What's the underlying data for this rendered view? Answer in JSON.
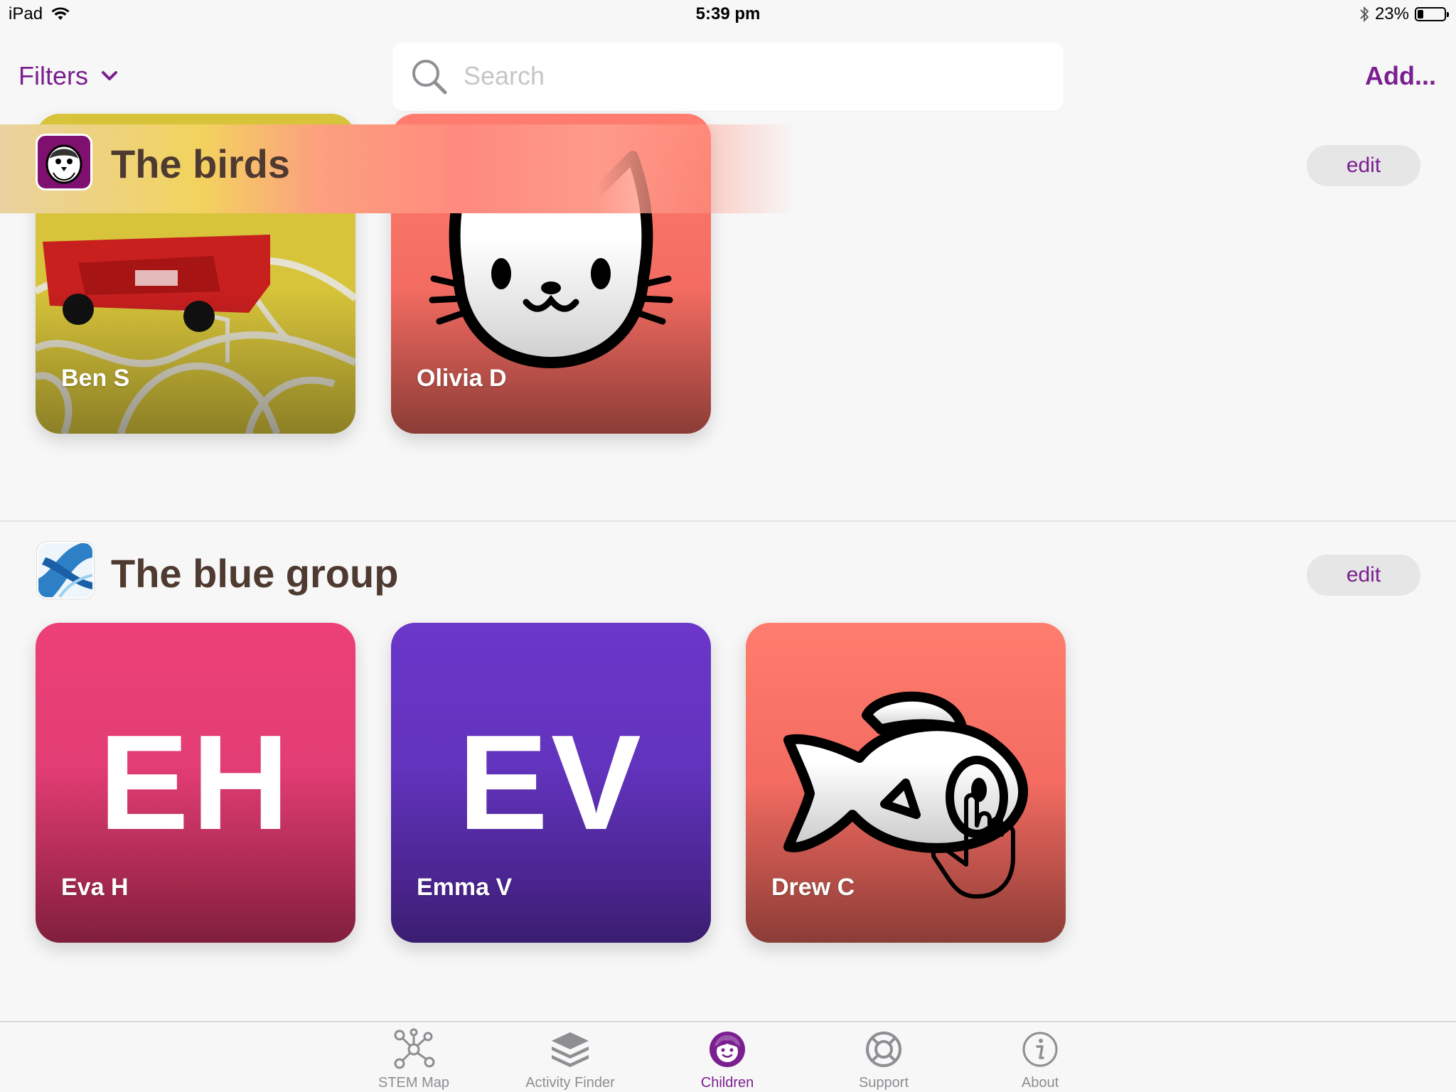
{
  "status_bar": {
    "device": "iPad",
    "time": "5:39 pm",
    "battery": "23%",
    "battery_level": 0.23
  },
  "nav": {
    "filters_label": "Filters",
    "search_placeholder": "Search",
    "add_label": "Add..."
  },
  "groups": [
    {
      "title": "The birds",
      "edit_label": "edit",
      "children": [
        {
          "name": "Ben S"
        },
        {
          "name": "Olivia D"
        }
      ]
    },
    {
      "title": "The blue group",
      "edit_label": "edit",
      "children": [
        {
          "name": "Eva H",
          "initials": "EH"
        },
        {
          "name": "Emma V",
          "initials": "EV"
        },
        {
          "name": "Drew C"
        }
      ]
    }
  ],
  "tabs": [
    {
      "label": "STEM Map",
      "icon": "network-icon",
      "active": false
    },
    {
      "label": "Activity Finder",
      "icon": "layers-icon",
      "active": false
    },
    {
      "label": "Children",
      "icon": "child-face-icon",
      "active": true
    },
    {
      "label": "Support",
      "icon": "lifebuoy-icon",
      "active": false
    },
    {
      "label": "About",
      "icon": "info-icon",
      "active": false
    }
  ],
  "colors": {
    "accent": "#7a1f8f",
    "title_text": "#4e3a30"
  }
}
